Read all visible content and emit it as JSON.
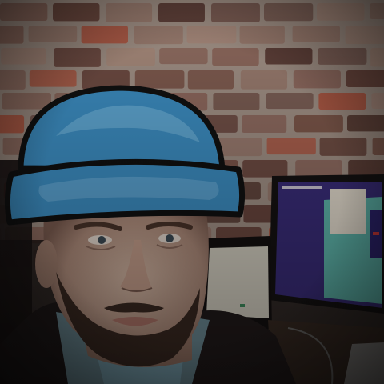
{
  "colors": {
    "brick_light": "#8f6a5e",
    "brick_dark": "#5a3b33",
    "mortar": "#b7a79b",
    "hat_blue": "#3d8fc4",
    "hat_highlight": "#6fb3dd",
    "hat_outline": "#111111",
    "skin": "#c9a896",
    "skin_shadow": "#8a6a5c",
    "beard": "#3b2a22",
    "jacket": "#26201f",
    "shirt_blue": "#7fa9b8",
    "monitor_screen_purple": "#3a2d7a",
    "monitor_screen_teal": "#5fb7ad",
    "monitor_bezel": "#1a1616",
    "laptop_screen": "#d9d4c6"
  },
  "icons": [
    "beanie-hat-drawing"
  ]
}
